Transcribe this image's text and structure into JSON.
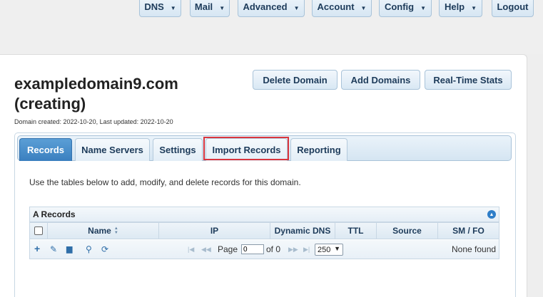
{
  "topnav": {
    "items": [
      {
        "label": "DNS",
        "has_menu": true
      },
      {
        "label": "Mail",
        "has_menu": true
      },
      {
        "label": "Advanced",
        "has_menu": true
      },
      {
        "label": "Account",
        "has_menu": true
      },
      {
        "label": "Config",
        "has_menu": true
      },
      {
        "label": "Help",
        "has_menu": true
      },
      {
        "label": "Logout",
        "has_menu": false
      }
    ]
  },
  "domain": {
    "title_line1": "exampledomain9.com",
    "title_line2": "(creating)",
    "meta": "Domain created: 2022-10-20, Last updated: 2022-10-20"
  },
  "actions": {
    "delete": "Delete Domain",
    "add": "Add Domains",
    "stats": "Real-Time Stats"
  },
  "tabs": [
    {
      "label": "Records",
      "active": true
    },
    {
      "label": "Name Servers",
      "active": false
    },
    {
      "label": "Settings",
      "active": false
    },
    {
      "label": "Import Records",
      "active": false,
      "highlighted": true
    },
    {
      "label": "Reporting",
      "active": false
    }
  ],
  "intro": "Use the tables below to add, modify, and delete records for this domain.",
  "a_records": {
    "title": "A Records",
    "columns": [
      "Name",
      "IP",
      "Dynamic DNS",
      "TTL",
      "Source",
      "SM / FO"
    ],
    "sort_indicator": "▲▼",
    "toolbar_icons": [
      "add-icon",
      "edit-icon",
      "delete-icon",
      "search-icon",
      "refresh-icon"
    ],
    "pager": {
      "page_label": "Page",
      "page_value": "0",
      "of_label": "of 0",
      "page_size": "250",
      "status": "None found"
    }
  },
  "colors": {
    "accent": "#3a7fbf",
    "highlight": "#d9363e"
  }
}
